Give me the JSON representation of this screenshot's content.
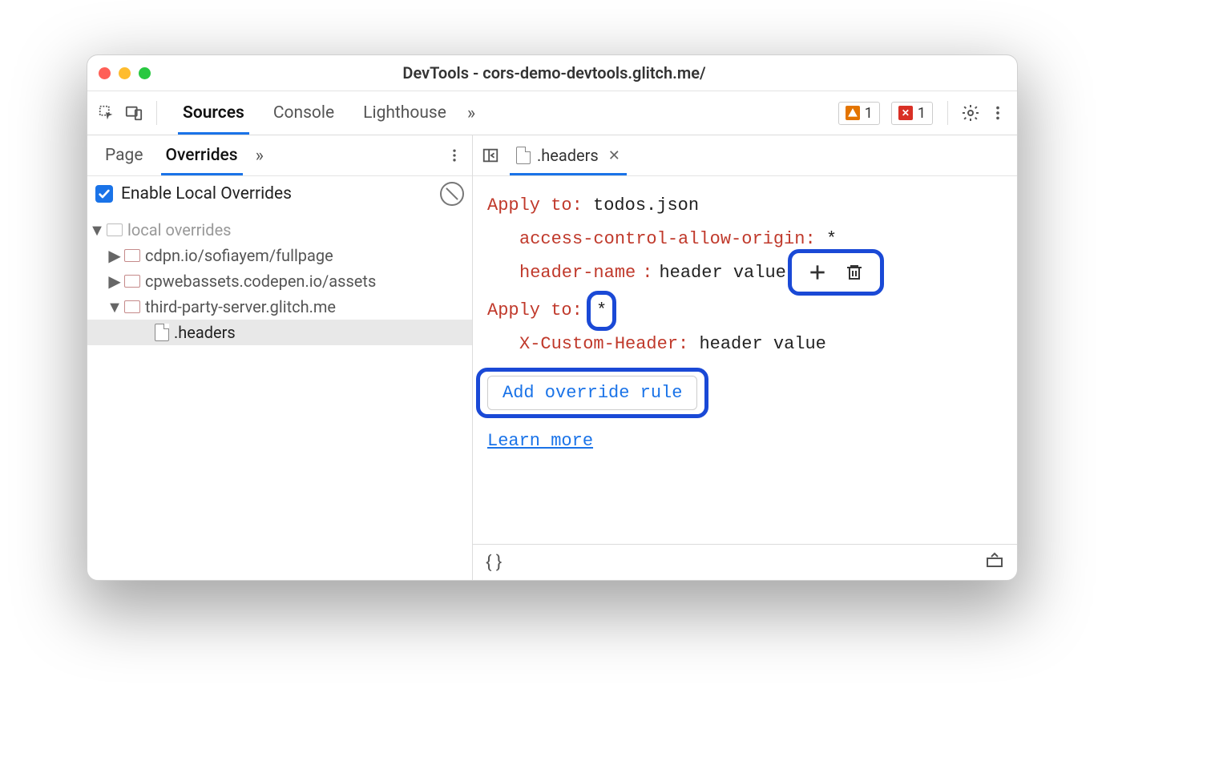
{
  "window": {
    "title": "DevTools - cors-demo-devtools.glitch.me/"
  },
  "toolbar": {
    "tabs": [
      "Sources",
      "Console",
      "Lighthouse"
    ],
    "activeTab": 0,
    "badges": {
      "warnings": "1",
      "errors": "1"
    }
  },
  "sidebar": {
    "tabs": [
      "Page",
      "Overrides"
    ],
    "activeTab": 1,
    "enable_label": "Enable Local Overrides",
    "enable_checked": true,
    "tree": {
      "root_label": "local overrides",
      "folders": [
        "cdpn.io/sofiayem/fullpage",
        "cpwebassets.codepen.io/assets",
        "third-party-server.glitch.me"
      ],
      "selected_file": ".headers"
    }
  },
  "editor": {
    "tab_label": ".headers",
    "rules": [
      {
        "apply_label": "Apply to",
        "apply_value": "todos.json",
        "headers": [
          {
            "name": "access-control-allow-origin",
            "value": "*"
          },
          {
            "name": "header-name",
            "value": "header value"
          }
        ]
      },
      {
        "apply_label": "Apply to",
        "apply_value": "*",
        "headers": [
          {
            "name": "X-Custom-Header",
            "value": "header value"
          }
        ]
      }
    ],
    "add_rule_label": "Add override rule",
    "learn_more_label": "Learn more"
  }
}
